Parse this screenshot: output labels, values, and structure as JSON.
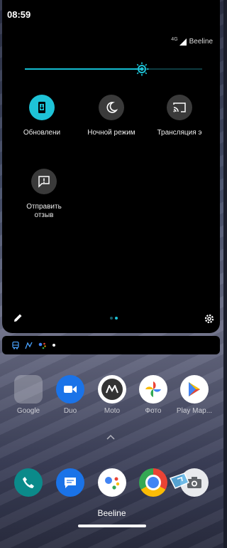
{
  "status_bar": {
    "time": "08:59"
  },
  "quick_settings": {
    "carrier": {
      "network": "4G",
      "name": "Beeline"
    },
    "brightness_level": 0.66,
    "tiles": [
      {
        "label": "Обновлени",
        "icon": "phone-update-icon",
        "active": true
      },
      {
        "label": "Ночной режим",
        "icon": "moon-icon",
        "active": false
      },
      {
        "label": "Трансляция э",
        "icon": "cast-icon",
        "active": false
      },
      {
        "label": "Отправить\nотзыв",
        "icon": "feedback-icon",
        "active": false
      }
    ],
    "page_indicator": {
      "pages": 2,
      "current": 1
    }
  },
  "notifications": {
    "icons": [
      "bus-icon",
      "maps-icon",
      "assistant-icon",
      "dot-icon"
    ]
  },
  "home_screen": {
    "apps_row1": [
      {
        "name": "Google",
        "icon": "google-folder-icon"
      },
      {
        "name": "Duo",
        "icon": "duo-icon"
      },
      {
        "name": "Moto",
        "icon": "moto-icon"
      },
      {
        "name": "Фото",
        "icon": "photos-icon"
      },
      {
        "name": "Play Мар...",
        "icon": "play-store-icon"
      }
    ],
    "dock": [
      {
        "icon": "phone-icon"
      },
      {
        "icon": "messages-icon"
      },
      {
        "icon": "assistant-icon"
      },
      {
        "icon": "chrome-icon"
      },
      {
        "icon": "camera-icon"
      }
    ],
    "carrier_label": "Beeline"
  },
  "colors": {
    "accent": "#1ec3d7",
    "panel": "#000000"
  }
}
